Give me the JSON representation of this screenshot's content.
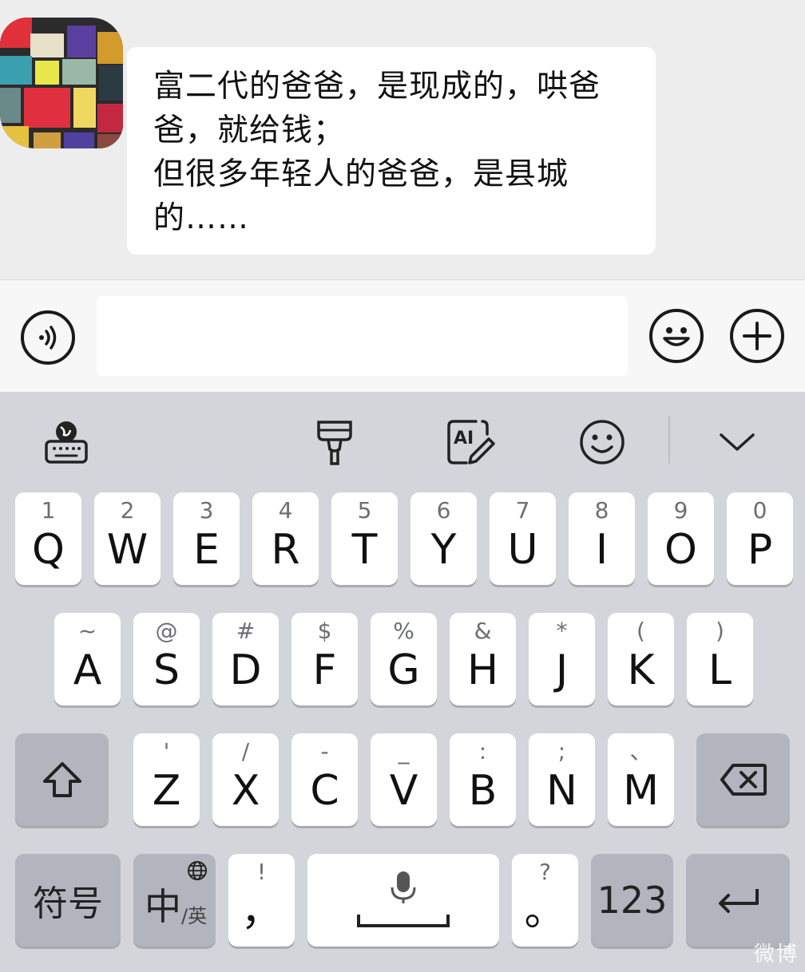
{
  "chat": {
    "message_text": "富二代的爸爸，是现成的，哄爸\n爸，就给钱；\n但很多年轻人的爸爸，是县城\n的……"
  },
  "input_bar": {
    "voice_icon": "voice-wave-icon",
    "emoji_icon": "emoji-smile-icon",
    "add_icon": "plus-icon",
    "input_value": ""
  },
  "keyboard_toolbar": {
    "icons": [
      "keyboard-globe-icon",
      "brush-icon",
      "ai-edit-icon",
      "emoji-icon",
      "collapse-chevron-icon"
    ]
  },
  "keyboard": {
    "row1": [
      {
        "main": "Q",
        "sub": "1"
      },
      {
        "main": "W",
        "sub": "2"
      },
      {
        "main": "E",
        "sub": "3"
      },
      {
        "main": "R",
        "sub": "4"
      },
      {
        "main": "T",
        "sub": "5"
      },
      {
        "main": "Y",
        "sub": "6"
      },
      {
        "main": "U",
        "sub": "7"
      },
      {
        "main": "I",
        "sub": "8"
      },
      {
        "main": "O",
        "sub": "9"
      },
      {
        "main": "P",
        "sub": "0"
      }
    ],
    "row2": [
      {
        "main": "A",
        "sub": "~"
      },
      {
        "main": "S",
        "sub": "@"
      },
      {
        "main": "D",
        "sub": "#"
      },
      {
        "main": "F",
        "sub": "$"
      },
      {
        "main": "G",
        "sub": "%"
      },
      {
        "main": "H",
        "sub": "&"
      },
      {
        "main": "J",
        "sub": "*"
      },
      {
        "main": "K",
        "sub": "("
      },
      {
        "main": "L",
        "sub": ")"
      }
    ],
    "row3": [
      {
        "main": "Z",
        "sub": "'"
      },
      {
        "main": "X",
        "sub": "/"
      },
      {
        "main": "C",
        "sub": "-"
      },
      {
        "main": "V",
        "sub": "_"
      },
      {
        "main": "B",
        "sub": ":"
      },
      {
        "main": "N",
        "sub": ";"
      },
      {
        "main": "M",
        "sub": "、"
      }
    ],
    "symbols_label": "符号",
    "lang_main": "中",
    "lang_sub": "/英",
    "comma": {
      "main": "，",
      "sub": "!"
    },
    "period": {
      "main": "。",
      "sub": "?"
    },
    "numbers_label": "123"
  },
  "watermark": "微博"
}
